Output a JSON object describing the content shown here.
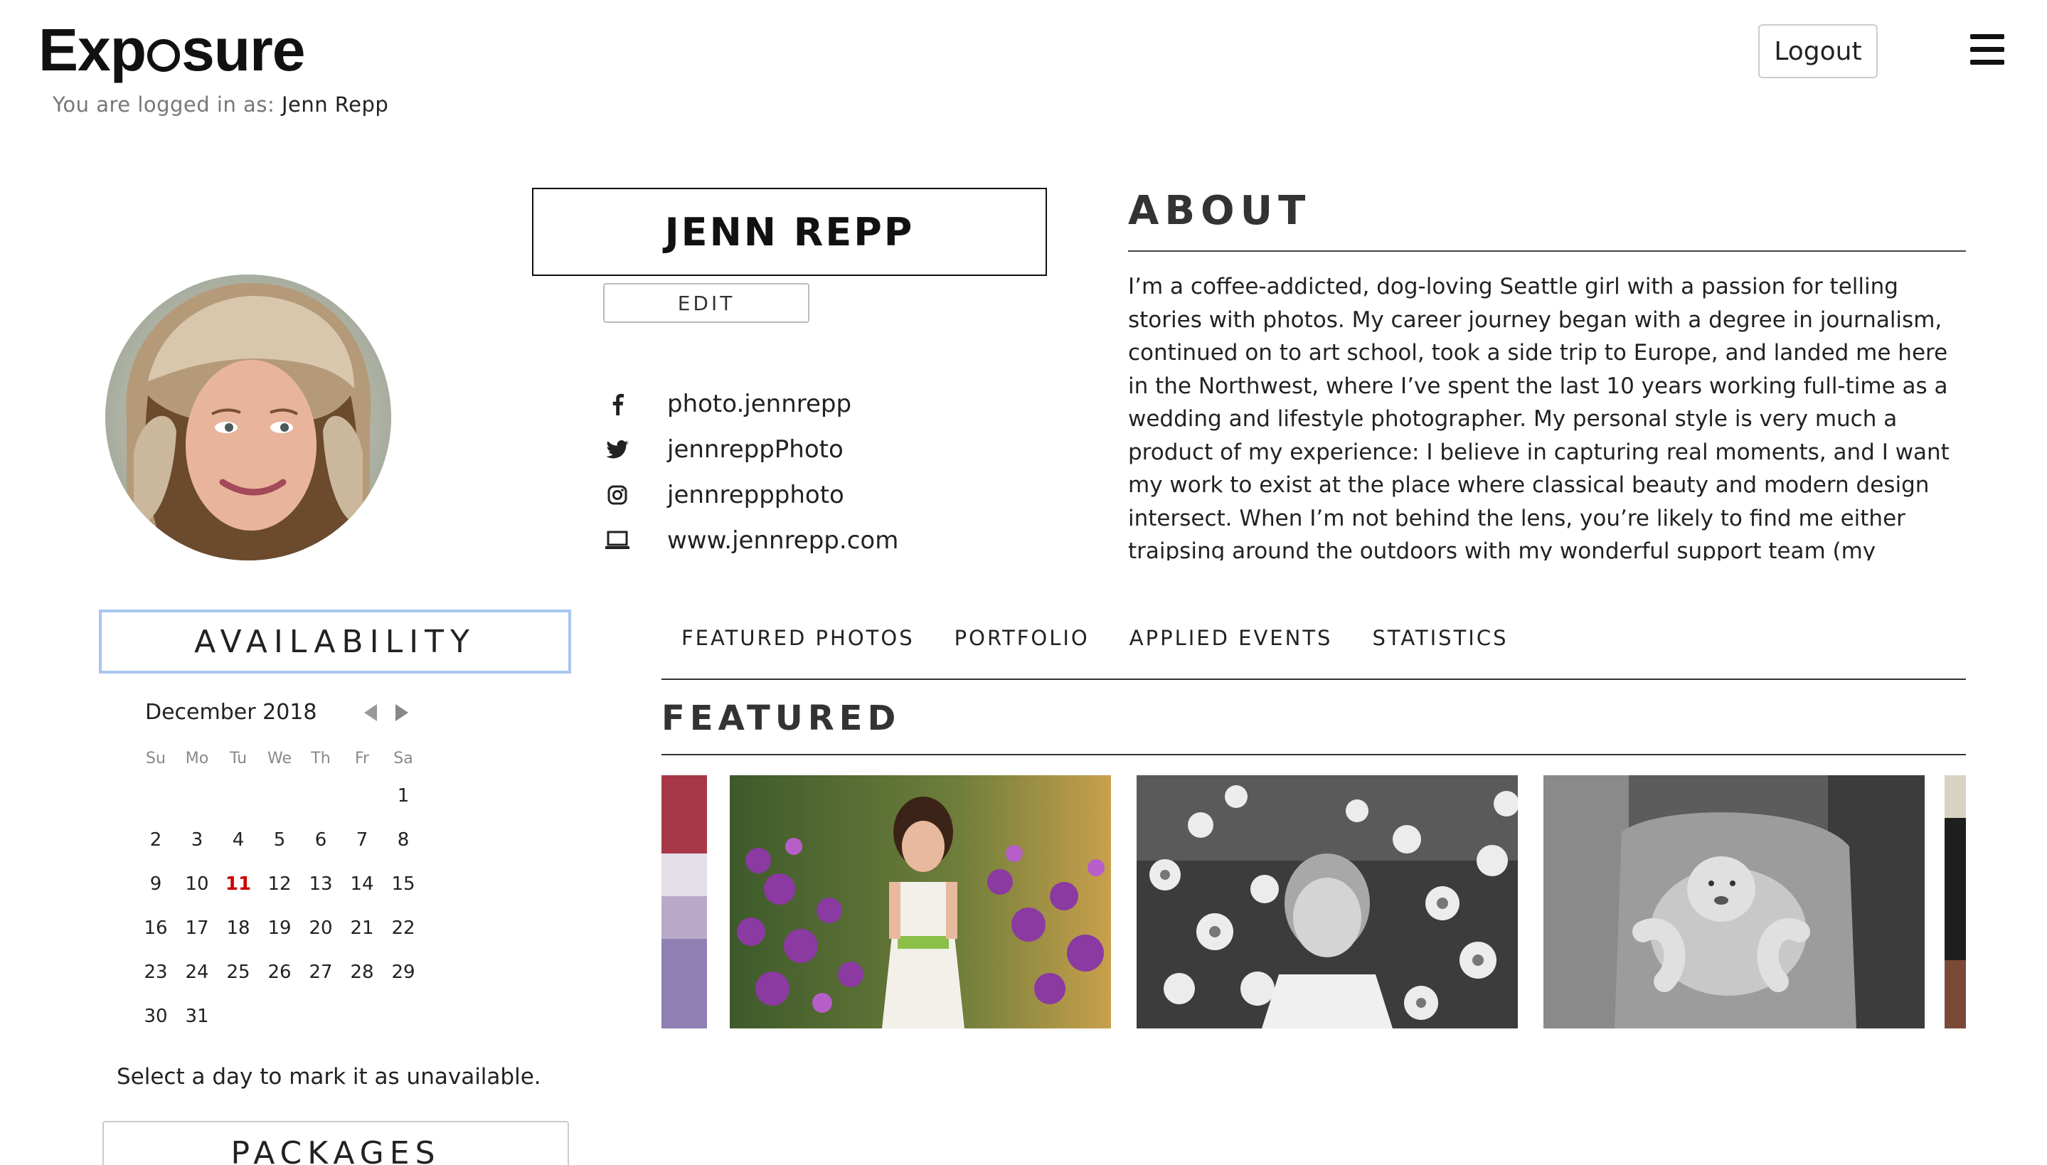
{
  "header": {
    "logo_pre": "Exp",
    "logo_post": "sure",
    "logged_in_label": "You are logged in as:",
    "logged_in_user": "Jenn Repp",
    "logout_label": "Logout",
    "menu_icon": "hamburger-icon"
  },
  "profile": {
    "name": "JENN REPP",
    "edit_label": "EDIT",
    "social": [
      {
        "icon": "facebook-icon",
        "text": "photo.jennrepp"
      },
      {
        "icon": "twitter-icon",
        "text": "jennreppPhoto"
      },
      {
        "icon": "instagram-icon",
        "text": "jennreppphoto"
      },
      {
        "icon": "laptop-icon",
        "text": "www.jennrepp.com"
      }
    ]
  },
  "about": {
    "title": "ABOUT",
    "text": "I’m a coffee-addicted, dog-loving Seattle girl with a passion for telling stories with photos. My career journey began with a degree in journalism, continued on to art school, took a side trip to Europe, and landed me here in the Northwest, where I’ve spent the last 10 years working full-time as a wedding and lifestyle photographer. My personal style is very much a product of my experience: I believe in capturing real moments, and I want my work to exist at the place where classical beauty and modern design intersect. When I’m not behind the lens, you’re likely to find me either traipsing around the outdoors with my wonderful support team (my amazing husband and our"
  },
  "availability": {
    "title": "AVAILABILITY",
    "month": "December 2018",
    "weekdays": [
      "Su",
      "Mo",
      "Tu",
      "We",
      "Th",
      "Fr",
      "Sa"
    ],
    "weeks": [
      [
        "",
        "",
        "",
        "",
        "",
        "",
        "1"
      ],
      [
        "2",
        "3",
        "4",
        "5",
        "6",
        "7",
        "8"
      ],
      [
        "9",
        "10",
        "11",
        "12",
        "13",
        "14",
        "15"
      ],
      [
        "16",
        "17",
        "18",
        "19",
        "20",
        "21",
        "22"
      ],
      [
        "23",
        "24",
        "25",
        "26",
        "27",
        "28",
        "29"
      ],
      [
        "30",
        "31",
        "",
        "",
        "",
        "",
        ""
      ]
    ],
    "today": "11",
    "hint": "Select a day to mark it as unavailable.",
    "packages_title": "PACKAGES",
    "colors": {
      "today": "#cc0000",
      "focus_border": "#a8c6ee"
    }
  },
  "tabs": {
    "items": [
      "FEATURED PHOTOS",
      "PORTFOLIO",
      "APPLIED EVENTS",
      "STATISTICS"
    ]
  },
  "featured": {
    "title": "FEATURED"
  }
}
